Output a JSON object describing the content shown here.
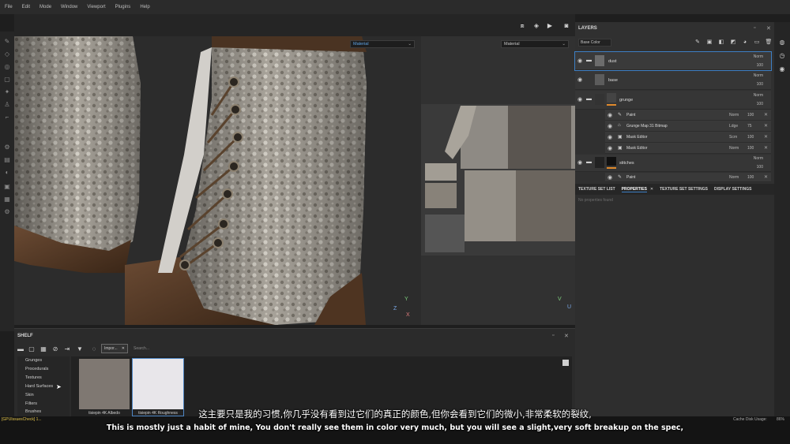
{
  "menu": {
    "items": [
      "File",
      "Edit",
      "Mode",
      "Window",
      "Viewport",
      "Plugins",
      "Help"
    ]
  },
  "viewport": {
    "left_mode": "Material",
    "right_mode": "Material",
    "gizmo_3d": {
      "y": "Y",
      "z": "Z",
      "x": "X"
    },
    "gizmo_2d": {
      "v": "V",
      "u": "U"
    }
  },
  "layers": {
    "title": "LAYERS",
    "channel": "Base Color",
    "rows": [
      {
        "name": "dust",
        "blend": "Norm",
        "opacity": "100"
      },
      {
        "name": "base",
        "blend": "Norm",
        "opacity": "100"
      },
      {
        "name": "grunge",
        "blend": "Norm",
        "opacity": "100"
      },
      {
        "name": "stitches",
        "blend": "Norm",
        "opacity": "100"
      }
    ],
    "grunge_effects": [
      {
        "name": "Paint",
        "blend": "Norm",
        "value": "100"
      },
      {
        "name": "Grunge Map 31 Bitmap",
        "blend": "Ldge",
        "value": "75"
      },
      {
        "name": "Mask Editor",
        "blend": "Scrn",
        "value": "100"
      },
      {
        "name": "Mask Editor",
        "blend": "Norm",
        "value": "100"
      }
    ],
    "stitches_effect": {
      "name": "Paint",
      "blend": "Norm",
      "value": "100"
    }
  },
  "properties": {
    "tabs": [
      "TEXTURE SET LIST",
      "PROPERTIES",
      "TEXTURE SET SETTINGS",
      "DISPLAY SETTINGS"
    ],
    "empty_text": "No properties found"
  },
  "shelf": {
    "title": "SHELF",
    "filter_tag": "Impor...",
    "search_placeholder": "Search...",
    "categories": [
      "Grunges",
      "Procedurals",
      "Textures",
      "Hard Surfaces",
      "Skin",
      "Filters",
      "Brushes"
    ],
    "assets": [
      {
        "label": "tisiepin 4K Albedo",
        "color": "#7f7872"
      },
      {
        "label": "tisiepin 4K Roughness",
        "color": "#e8e6ea"
      }
    ]
  },
  "status": {
    "left": "[GPUIssuesCheck] 1...",
    "cache": "Cache Disk Usage:",
    "pct": "86%"
  },
  "subtitles": {
    "cn": "这主要只是我的习惯,你几乎没有看到过它们的真正的颜色,但你会看到它们的微小,非常柔软的裂纹,",
    "en": "This is mostly just a habit of mine, You don't really see them in color very much, but you will see a slight,very soft breakup on the spec,"
  },
  "colors": {
    "accent": "#3d7fc4",
    "panel": "#303030",
    "status_warn": "#e0c24a"
  }
}
